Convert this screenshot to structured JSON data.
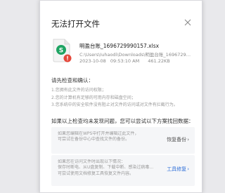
{
  "dialog": {
    "title": "无法打开文件",
    "file": {
      "name": "明盈台账_1696729990157.xlsx",
      "path": "C:\\Users\\Iuhaodi\\Downloads\\明盈台账_1696729990157.xlsx",
      "date": "2023-10-08",
      "time": "09:53:10 AM",
      "size": "461.22KB",
      "icon": "excel-file-warning-icon",
      "icon_color": "#1fa463",
      "warning_color": "#e5483b"
    },
    "checks": {
      "heading": "请先检查和确认：",
      "items": [
        "1.您拥有此文件的访问权限；",
        "2.您的计算机有足够的可用内存和磁盘空间；",
        "3.您系统中的安全软件没有阻止对文件的访问或对文件有拦截行为。"
      ]
    },
    "recovery": {
      "heading": "如果以上检查均未发现问题，您可以尝试以下方案找回数据：",
      "cards": [
        {
          "lines": [
            "如果您编辑在WPS中打开并编辑过此文件，",
            "可尝试在备份中心中查找文件的备份。"
          ],
          "action": "恢复备份",
          "action_color": "#555555"
        },
        {
          "lines": [
            "如果您在访问文件时出现以下情况：",
            "保存时断电、从U盘复制、下载中断、感染过病毒...",
            "可尝试使用文档修复工具恢复文件内容。"
          ],
          "action": "工具修复",
          "action_color": "#2f6fd8"
        }
      ]
    }
  }
}
